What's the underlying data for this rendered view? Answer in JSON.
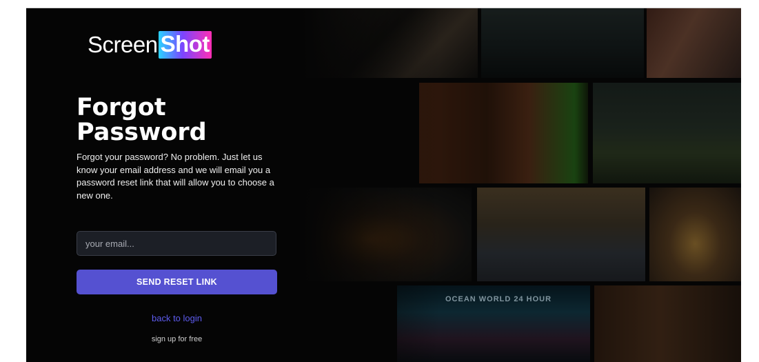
{
  "brand": {
    "part1": "Screen",
    "part2": "Shot",
    "gradient_colors": [
      "#2ad3ff",
      "#7a45ff",
      "#ff2fb4"
    ]
  },
  "form": {
    "title_line1": "Forgot",
    "title_line2": "Password",
    "description": "Forgot your password? No problem. Just let us know your email address and we will email you a password reset link that will allow you to choose a new one.",
    "email_placeholder": "your email...",
    "email_value": "",
    "submit_label": "SEND RESET LINK",
    "back_link": "back to login",
    "signup_link": "sign up for free"
  },
  "colors": {
    "background": "#050505",
    "button": "#5551d1",
    "link": "#5e5cf0"
  },
  "mosaic": {
    "sign_text": "OCEAN WORLD 24 HOUR"
  }
}
